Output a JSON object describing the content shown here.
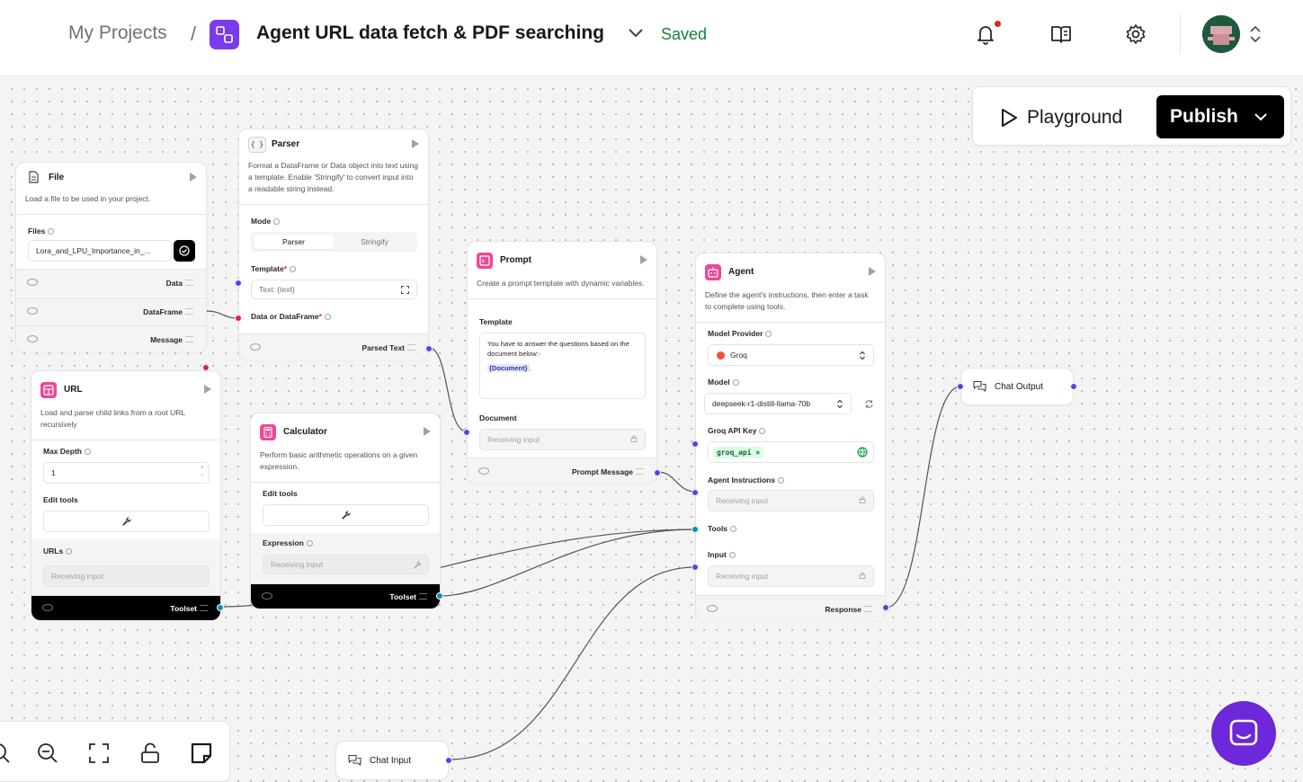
{
  "header": {
    "breadcrumb_root": "My Projects",
    "separator": "/",
    "project_title": "Agent URL data fetch & PDF searching",
    "save_status": "Saved",
    "icons": [
      "bell-icon",
      "book-icon",
      "gear-icon"
    ]
  },
  "actions": {
    "playground_label": "Playground",
    "publish_label": "Publish"
  },
  "nodes": {
    "file": {
      "title": "File",
      "description": "Load a file to be used in your project.",
      "files_label": "Files",
      "file_value": "Lora_and_LPU_Importance_in_...",
      "outputs": [
        "Data",
        "DataFrame",
        "Message"
      ]
    },
    "parser": {
      "icon_text": "{ }",
      "title": "Parser",
      "description": "Format a DataFrame or Data object into text using a template. Enable 'Stringify' to convert input into a readable string instead.",
      "mode_label": "Mode",
      "mode_options": [
        "Parser",
        "Stringify"
      ],
      "template_label": "Template",
      "template_placeholder": "Text: {text}",
      "input_label": "Data or DataFrame",
      "output": "Parsed Text"
    },
    "prompt": {
      "title": "Prompt",
      "description": "Create a prompt template with dynamic variables.",
      "template_label": "Template",
      "template_text": "You have to answer the questions based on the document below:-",
      "template_var": "{Document}",
      "template_suffix": ".",
      "document_label": "Document",
      "document_placeholder": "Receiving input",
      "output": "Prompt Message"
    },
    "agent": {
      "title": "Agent",
      "description": "Define the agent's instructions, then enter a task to complete using tools.",
      "provider_label": "Model Provider",
      "provider_value": "Groq",
      "model_label": "Model",
      "model_value": "deepseek-r1-distill-llama-70b",
      "api_key_label": "Groq API Key",
      "api_key_value": "groq_api",
      "instructions_label": "Agent Instructions",
      "instructions_placeholder": "Receiving input",
      "tools_label": "Tools",
      "input_label": "Input",
      "input_placeholder": "Receiving input",
      "output": "Response"
    },
    "url": {
      "title": "URL",
      "description": "Load and parse child links from a root URL recursively",
      "max_depth_label": "Max Depth",
      "max_depth_value": "1",
      "edit_tools_label": "Edit tools",
      "urls_label": "URLs",
      "urls_placeholder": "Receiving input",
      "output": "Toolset"
    },
    "calculator": {
      "title": "Calculator",
      "description": "Perform basic arithmetic operations on a given expression.",
      "edit_tools_label": "Edit tools",
      "expression_label": "Expression",
      "expression_placeholder": "Receiving input",
      "output": "Toolset"
    },
    "chat_output": {
      "title": "Chat Output"
    },
    "chat_input": {
      "title": "Chat Input"
    }
  },
  "colors": {
    "accent": "#7c3aed",
    "saved": "#16803c",
    "handle_blue": "#4f46e5",
    "handle_red": "#e11d48",
    "handle_teal": "#0891b2",
    "node_icon_pink": "#ec4899",
    "chat_launcher": "#6d28d9"
  },
  "toolbar": {
    "icons": [
      "zoom-in-icon",
      "zoom-out-icon",
      "fit-view-icon",
      "unlock-icon",
      "sticky-note-icon"
    ]
  }
}
